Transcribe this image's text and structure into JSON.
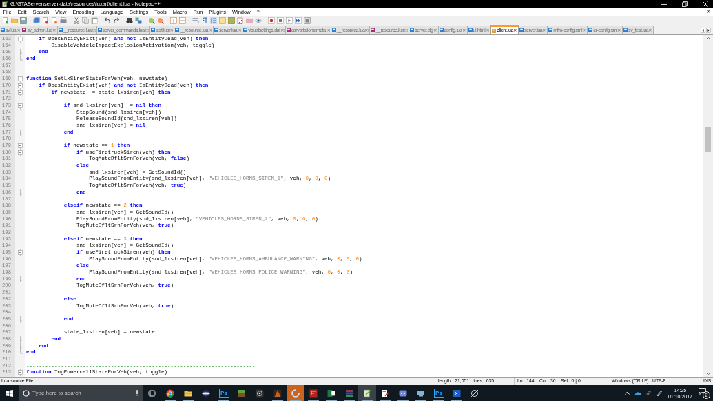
{
  "window": {
    "title": "G:\\GTAServer\\server-data\\resources\\luxart\\client.lua - Notepad++"
  },
  "menu": {
    "items": [
      "File",
      "Edit",
      "Search",
      "View",
      "Encoding",
      "Language",
      "Settings",
      "Tools",
      "Macro",
      "Run",
      "Plugins",
      "Window",
      "?"
    ],
    "close_document": "X"
  },
  "tabs": [
    {
      "label": "sv.lua",
      "selected": false,
      "modified": false
    },
    {
      "label": "sv_admin.lua",
      "selected": false,
      "modified": true
    },
    {
      "label": "__resource.lua",
      "selected": false,
      "modified": false
    },
    {
      "label": "server_commands.lua",
      "selected": false,
      "modified": false
    },
    {
      "label": "test.lua",
      "selected": false,
      "modified": false
    },
    {
      "label": "__resource.lua",
      "selected": false,
      "modified": false
    },
    {
      "label": "server.lua",
      "selected": false,
      "modified": false
    },
    {
      "label": "visualsettings.dat",
      "selected": false,
      "modified": false
    },
    {
      "label": "carvariations.meta",
      "selected": false,
      "modified": true
    },
    {
      "label": "__resource.lua",
      "selected": false,
      "modified": false
    },
    {
      "label": "__resource.lua",
      "selected": false,
      "modified": true
    },
    {
      "label": "server.cfg",
      "selected": false,
      "modified": false
    },
    {
      "label": "config.lua",
      "selected": false,
      "modified": false
    },
    {
      "label": "ui.html",
      "selected": false,
      "modified": false
    },
    {
      "label": "client.lua",
      "selected": true,
      "modified": false
    },
    {
      "label": "server.lua",
      "selected": false,
      "modified": false
    },
    {
      "label": "mfm-config.xml",
      "selected": false,
      "modified": false
    },
    {
      "label": "er-config.xml",
      "selected": false,
      "modified": false
    },
    {
      "label": "sv_test.lua",
      "selected": false,
      "modified": false
    }
  ],
  "editor": {
    "lines": [
      {
        "number": "163",
        "kind": "fold-start",
        "tokens": [
          {
            "kind": "kw",
            "text": "    if"
          },
          {
            "kind": "plain",
            "text": " DoesEntityExist(veh) "
          },
          {
            "kind": "kw",
            "text": "and not"
          },
          {
            "kind": "plain",
            "text": " IsEntityDead(veh) "
          },
          {
            "kind": "kw",
            "text": "then"
          }
        ]
      },
      {
        "number": "164",
        "kind": "plain",
        "tokens": [
          {
            "kind": "plain",
            "text": "        DisableVehicleImpactExplosionActivation(veh, toggle)"
          }
        ]
      },
      {
        "number": "165",
        "kind": "fold-middle",
        "tokens": [
          {
            "kind": "kw",
            "text": "    end"
          }
        ]
      },
      {
        "number": "166",
        "kind": "fold-end",
        "tokens": [
          {
            "kind": "kw",
            "text": "end"
          }
        ]
      },
      {
        "number": "167",
        "kind": "plain"
      },
      {
        "number": "168",
        "kind": "plain",
        "tokens": [
          {
            "kind": "comment",
            "text": "-------------------------------------------------------------------------"
          }
        ]
      },
      {
        "number": "169",
        "kind": "fold-start",
        "tokens": [
          {
            "kind": "kw",
            "text": "function"
          },
          {
            "kind": "plain",
            "text": " SetLxSirenStateForVeh(veh, newstate)"
          }
        ]
      },
      {
        "number": "170",
        "kind": "fold-start",
        "tokens": [
          {
            "kind": "kw",
            "text": "    if"
          },
          {
            "kind": "plain",
            "text": " DoesEntityExist(veh) "
          },
          {
            "kind": "kw",
            "text": "and not"
          },
          {
            "kind": "plain",
            "text": " IsEntityDead(veh) "
          },
          {
            "kind": "kw",
            "text": "then"
          }
        ]
      },
      {
        "number": "171",
        "kind": "fold-start",
        "tokens": [
          {
            "kind": "kw",
            "text": "        if"
          },
          {
            "kind": "plain",
            "text": " newstate ~= state_lxsiren[veh] "
          },
          {
            "kind": "kw",
            "text": "then"
          }
        ]
      },
      {
        "number": "172",
        "kind": "plain"
      },
      {
        "number": "173",
        "kind": "fold-start",
        "tokens": [
          {
            "kind": "kw",
            "text": "            if"
          },
          {
            "kind": "plain",
            "text": " snd_lxsiren[veh] ~= "
          },
          {
            "kind": "kw",
            "text": "nil then"
          }
        ]
      },
      {
        "number": "174",
        "kind": "plain",
        "tokens": [
          {
            "kind": "plain",
            "text": "                StopSound(snd_lxsiren[veh])"
          }
        ]
      },
      {
        "number": "175",
        "kind": "plain",
        "tokens": [
          {
            "kind": "plain",
            "text": "                ReleaseSoundId(snd_lxsiren[veh])"
          }
        ]
      },
      {
        "number": "176",
        "kind": "plain",
        "tokens": [
          {
            "kind": "plain",
            "text": "                snd_lxsiren[veh] = "
          },
          {
            "kind": "kw",
            "text": "nil"
          }
        ]
      },
      {
        "number": "177",
        "kind": "fold-middle",
        "tokens": [
          {
            "kind": "kw",
            "text": "            end"
          }
        ]
      },
      {
        "number": "178",
        "kind": "plain"
      },
      {
        "number": "179",
        "kind": "fold-start",
        "tokens": [
          {
            "kind": "kw",
            "text": "            if"
          },
          {
            "kind": "plain",
            "text": " newstate == "
          },
          {
            "kind": "num",
            "text": "1"
          },
          {
            "kind": "kw",
            "text": " then"
          }
        ]
      },
      {
        "number": "180",
        "kind": "fold-start",
        "tokens": [
          {
            "kind": "kw",
            "text": "                if"
          },
          {
            "kind": "plain",
            "text": " useFiretruckSiren(veh) "
          },
          {
            "kind": "kw",
            "text": "then"
          }
        ]
      },
      {
        "number": "181",
        "kind": "plain",
        "tokens": [
          {
            "kind": "plain",
            "text": "                    TogMuteDfltSrnForVeh(veh, "
          },
          {
            "kind": "kw",
            "text": "false"
          },
          {
            "kind": "plain",
            "text": ")"
          }
        ]
      },
      {
        "number": "182",
        "kind": "plain",
        "tokens": [
          {
            "kind": "kw",
            "text": "                else"
          }
        ]
      },
      {
        "number": "183",
        "kind": "plain",
        "tokens": [
          {
            "kind": "plain",
            "text": "                    snd_lxsiren[veh] = GetSoundId()"
          }
        ]
      },
      {
        "number": "184",
        "kind": "plain",
        "tokens": [
          {
            "kind": "plain",
            "text": "                    PlaySoundFromEntity(snd_lxsiren[veh], "
          },
          {
            "kind": "str",
            "text": "\"VEHICLES_HORNS_SIREN_1\""
          },
          {
            "kind": "plain",
            "text": ", veh, "
          },
          {
            "kind": "num",
            "text": "0"
          },
          {
            "kind": "plain",
            "text": ", "
          },
          {
            "kind": "num",
            "text": "0"
          },
          {
            "kind": "plain",
            "text": ", "
          },
          {
            "kind": "num",
            "text": "0"
          },
          {
            "kind": "plain",
            "text": ")"
          }
        ]
      },
      {
        "number": "185",
        "kind": "plain",
        "tokens": [
          {
            "kind": "plain",
            "text": "                    TogMuteDfltSrnForVeh(veh, "
          },
          {
            "kind": "kw",
            "text": "true"
          },
          {
            "kind": "plain",
            "text": ")"
          }
        ]
      },
      {
        "number": "186",
        "kind": "fold-middle",
        "tokens": [
          {
            "kind": "kw",
            "text": "                end"
          }
        ]
      },
      {
        "number": "187",
        "kind": "plain"
      },
      {
        "number": "188",
        "kind": "plain",
        "tokens": [
          {
            "kind": "kw",
            "text": "            elseif"
          },
          {
            "kind": "plain",
            "text": " newstate == "
          },
          {
            "kind": "num",
            "text": "2"
          },
          {
            "kind": "kw",
            "text": " then"
          }
        ]
      },
      {
        "number": "189",
        "kind": "plain",
        "tokens": [
          {
            "kind": "plain",
            "text": "                snd_lxsiren[veh] = GetSoundId()"
          }
        ]
      },
      {
        "number": "190",
        "kind": "plain",
        "tokens": [
          {
            "kind": "plain",
            "text": "                PlaySoundFromEntity(snd_lxsiren[veh], "
          },
          {
            "kind": "str",
            "text": "\"VEHICLES_HORNS_SIREN_2\""
          },
          {
            "kind": "plain",
            "text": ", veh, "
          },
          {
            "kind": "num",
            "text": "0"
          },
          {
            "kind": "plain",
            "text": ", "
          },
          {
            "kind": "num",
            "text": "0"
          },
          {
            "kind": "plain",
            "text": ", "
          },
          {
            "kind": "num",
            "text": "0"
          },
          {
            "kind": "plain",
            "text": ")"
          }
        ]
      },
      {
        "number": "191",
        "kind": "plain",
        "tokens": [
          {
            "kind": "plain",
            "text": "                TogMuteDfltSrnForVeh(veh, "
          },
          {
            "kind": "kw",
            "text": "true"
          },
          {
            "kind": "plain",
            "text": ")"
          }
        ]
      },
      {
        "number": "192",
        "kind": "plain"
      },
      {
        "number": "193",
        "kind": "plain",
        "tokens": [
          {
            "kind": "kw",
            "text": "            elseif"
          },
          {
            "kind": "plain",
            "text": " newstate == "
          },
          {
            "kind": "num",
            "text": "3"
          },
          {
            "kind": "kw",
            "text": " then"
          }
        ]
      },
      {
        "number": "194",
        "kind": "plain",
        "tokens": [
          {
            "kind": "plain",
            "text": "                snd_lxsiren[veh] = GetSoundId()"
          }
        ]
      },
      {
        "number": "195",
        "kind": "fold-start",
        "tokens": [
          {
            "kind": "kw",
            "text": "                if"
          },
          {
            "kind": "plain",
            "text": " useFiretruckSiren(veh) "
          },
          {
            "kind": "kw",
            "text": "then"
          }
        ]
      },
      {
        "number": "196",
        "kind": "plain",
        "tokens": [
          {
            "kind": "plain",
            "text": "                    PlaySoundFromEntity(snd_lxsiren[veh], "
          },
          {
            "kind": "str",
            "text": "\"VEHICLES_HORNS_AMBULANCE_WARNING\""
          },
          {
            "kind": "plain",
            "text": ", veh, "
          },
          {
            "kind": "num",
            "text": "0"
          },
          {
            "kind": "plain",
            "text": ", "
          },
          {
            "kind": "num",
            "text": "0"
          },
          {
            "kind": "plain",
            "text": ", "
          },
          {
            "kind": "num",
            "text": "0"
          },
          {
            "kind": "plain",
            "text": ")"
          }
        ]
      },
      {
        "number": "197",
        "kind": "plain",
        "tokens": [
          {
            "kind": "kw",
            "text": "                else"
          }
        ]
      },
      {
        "number": "198",
        "kind": "plain",
        "tokens": [
          {
            "kind": "plain",
            "text": "                    PlaySoundFromEntity(snd_lxsiren[veh], "
          },
          {
            "kind": "str",
            "text": "\"VEHICLES_HORNS_POLICE_WARNING\""
          },
          {
            "kind": "plain",
            "text": ", veh, "
          },
          {
            "kind": "num",
            "text": "0"
          },
          {
            "kind": "plain",
            "text": ", "
          },
          {
            "kind": "num",
            "text": "0"
          },
          {
            "kind": "plain",
            "text": ", "
          },
          {
            "kind": "num",
            "text": "0"
          },
          {
            "kind": "plain",
            "text": ")"
          }
        ]
      },
      {
        "number": "199",
        "kind": "fold-middle",
        "tokens": [
          {
            "kind": "kw",
            "text": "                end"
          }
        ]
      },
      {
        "number": "200",
        "kind": "plain",
        "tokens": [
          {
            "kind": "plain",
            "text": "                TogMuteDfltSrnForVeh(veh, "
          },
          {
            "kind": "kw",
            "text": "true"
          },
          {
            "kind": "plain",
            "text": ")"
          }
        ]
      },
      {
        "number": "201",
        "kind": "plain"
      },
      {
        "number": "202",
        "kind": "plain",
        "tokens": [
          {
            "kind": "kw",
            "text": "            else"
          }
        ]
      },
      {
        "number": "203",
        "kind": "plain",
        "tokens": [
          {
            "kind": "plain",
            "text": "                TogMuteDfltSrnForVeh(veh, "
          },
          {
            "kind": "kw",
            "text": "true"
          },
          {
            "kind": "plain",
            "text": ")"
          }
        ]
      },
      {
        "number": "204",
        "kind": "plain"
      },
      {
        "number": "205",
        "kind": "fold-middle",
        "tokens": [
          {
            "kind": "kw",
            "text": "            end"
          }
        ]
      },
      {
        "number": "206",
        "kind": "plain"
      },
      {
        "number": "207",
        "kind": "plain",
        "tokens": [
          {
            "kind": "plain",
            "text": "            state_lxsiren[veh] = newstate"
          }
        ]
      },
      {
        "number": "208",
        "kind": "fold-middle",
        "tokens": [
          {
            "kind": "kw",
            "text": "        end"
          }
        ]
      },
      {
        "number": "209",
        "kind": "fold-middle",
        "tokens": [
          {
            "kind": "kw",
            "text": "    end"
          }
        ]
      },
      {
        "number": "210",
        "kind": "fold-end",
        "tokens": [
          {
            "kind": "kw",
            "text": "end"
          }
        ]
      },
      {
        "number": "211",
        "kind": "plain"
      },
      {
        "number": "212",
        "kind": "plain",
        "tokens": [
          {
            "kind": "comment",
            "text": "-------------------------------------------------------------------------"
          }
        ]
      },
      {
        "number": "213",
        "kind": "fold-start",
        "tokens": [
          {
            "kind": "kw",
            "text": "function"
          },
          {
            "kind": "plain",
            "text": " TogPowercallStateForVeh(veh, toggle)"
          }
        ]
      }
    ]
  },
  "status_bar": {
    "file_type": "Lua source File",
    "length": "length : 21,051",
    "lines": "lines : 635",
    "position": "Ln : 144    Col : 36    Sel : 0 | 0",
    "eol": "Windows (CR LF)",
    "encoding": "UTF-8",
    "mode": "INS"
  },
  "taskbar": {
    "search_placeholder": "Type here to search",
    "icon_labels": [
      "Ps",
      "Ps"
    ],
    "time": "14:25",
    "date": "01/10/2017",
    "notification_count": "2"
  }
}
